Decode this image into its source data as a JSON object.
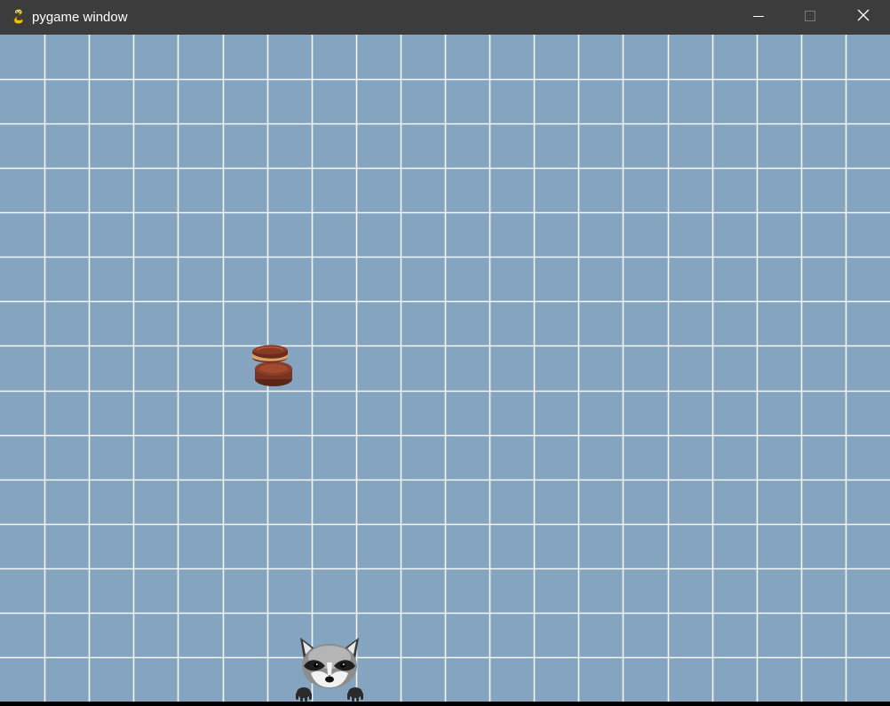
{
  "window": {
    "title": "pygame window",
    "icon": "pygame-snake-icon",
    "controls": [
      "minimize-icon",
      "maximize-icon",
      "close-icon"
    ]
  },
  "game": {
    "background_color": "#84a4c0",
    "grid_line_color": "#f4f6f8",
    "grid": {
      "columns": 20,
      "rows": 15
    },
    "objects": [
      {
        "name": "falling-cookie-sprite",
        "kind": "chocolate sandwich cookie"
      },
      {
        "name": "raccoon-player-sprite",
        "kind": "raccoon"
      }
    ]
  }
}
